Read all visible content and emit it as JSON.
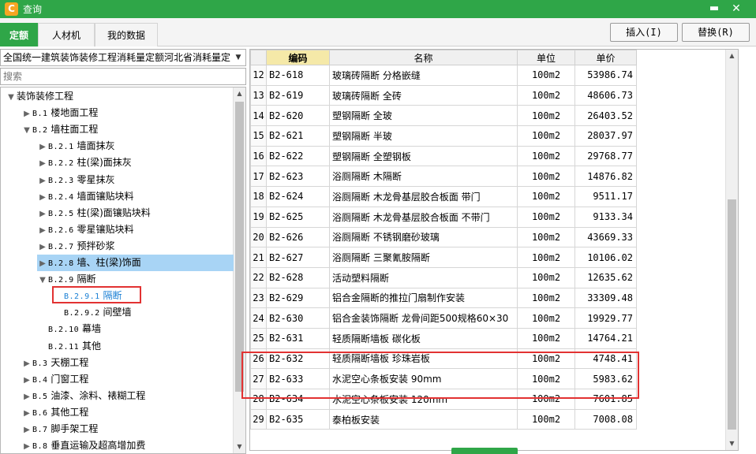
{
  "window": {
    "title": "查询",
    "app_icon": "C",
    "min_glyph": "▬",
    "close_glyph": "✕"
  },
  "tabs": [
    {
      "label": "定额",
      "active": true
    },
    {
      "label": "人材机",
      "active": false
    },
    {
      "label": "我的数据",
      "active": false
    }
  ],
  "toolbar": {
    "insert_label": "插入(I)",
    "replace_label": "替换(R)"
  },
  "library": {
    "selected": "全国统一建筑装饰装修工程消耗量定额河北省消耗量定"
  },
  "search": {
    "placeholder": "搜索"
  },
  "tree": [
    {
      "code": "",
      "label": "装饰装修工程",
      "toggle": "▼",
      "level": 0
    },
    {
      "code": "B.1",
      "label": "楼地面工程",
      "toggle": "▶",
      "level": 1
    },
    {
      "code": "B.2",
      "label": "墙柱面工程",
      "toggle": "▼",
      "level": 1
    },
    {
      "code": "B.2.1",
      "label": "墙面抹灰",
      "toggle": "▶",
      "level": 2
    },
    {
      "code": "B.2.2",
      "label": "柱(梁)面抹灰",
      "toggle": "▶",
      "level": 2
    },
    {
      "code": "B.2.3",
      "label": "零星抹灰",
      "toggle": "▶",
      "level": 2
    },
    {
      "code": "B.2.4",
      "label": "墙面镶贴块料",
      "toggle": "▶",
      "level": 2
    },
    {
      "code": "B.2.5",
      "label": "柱(梁)面镶贴块料",
      "toggle": "▶",
      "level": 2
    },
    {
      "code": "B.2.6",
      "label": "零星镶贴块料",
      "toggle": "▶",
      "level": 2
    },
    {
      "code": "B.2.7",
      "label": "预拌砂浆",
      "toggle": "▶",
      "level": 2
    },
    {
      "code": "B.2.8",
      "label": "墙、柱(梁)饰面",
      "toggle": "▶",
      "level": 2,
      "selected": true
    },
    {
      "code": "B.2.9",
      "label": "隔断",
      "toggle": "▼",
      "level": 2
    },
    {
      "code": "B.2.9.1",
      "label": "隔断",
      "toggle": "",
      "level": 3,
      "current": true
    },
    {
      "code": "B.2.9.2",
      "label": "间壁墙",
      "toggle": "",
      "level": 3
    },
    {
      "code": "B.2.10",
      "label": "幕墙",
      "toggle": "",
      "level": 2
    },
    {
      "code": "B.2.11",
      "label": "其他",
      "toggle": "",
      "level": 2
    },
    {
      "code": "B.3",
      "label": "天棚工程",
      "toggle": "▶",
      "level": 1
    },
    {
      "code": "B.4",
      "label": "门窗工程",
      "toggle": "▶",
      "level": 1
    },
    {
      "code": "B.5",
      "label": "油漆、涂料、裱糊工程",
      "toggle": "▶",
      "level": 1
    },
    {
      "code": "B.6",
      "label": "其他工程",
      "toggle": "▶",
      "level": 1
    },
    {
      "code": "B.7",
      "label": "脚手架工程",
      "toggle": "▶",
      "level": 1
    },
    {
      "code": "B.8",
      "label": "垂直运输及超高增加费",
      "toggle": "▶",
      "level": 1
    }
  ],
  "table": {
    "headers": {
      "no": "",
      "code": "编码",
      "name": "名称",
      "unit": "单位",
      "price": "单价"
    },
    "rows": [
      {
        "no": "12",
        "code": "B2-618",
        "name": "玻璃砖隔断 分格嵌缝",
        "unit": "100m2",
        "price": "53986.74"
      },
      {
        "no": "13",
        "code": "B2-619",
        "name": "玻璃砖隔断 全砖",
        "unit": "100m2",
        "price": "48606.73"
      },
      {
        "no": "14",
        "code": "B2-620",
        "name": "塑钢隔断 全玻",
        "unit": "100m2",
        "price": "26403.52"
      },
      {
        "no": "15",
        "code": "B2-621",
        "name": "塑钢隔断 半玻",
        "unit": "100m2",
        "price": "28037.97"
      },
      {
        "no": "16",
        "code": "B2-622",
        "name": "塑钢隔断 全塑钢板",
        "unit": "100m2",
        "price": "29768.77"
      },
      {
        "no": "17",
        "code": "B2-623",
        "name": "浴厕隔断 木隔断",
        "unit": "100m2",
        "price": "14876.82"
      },
      {
        "no": "18",
        "code": "B2-624",
        "name": "浴厕隔断 木龙骨基层胶合板面 带门",
        "unit": "100m2",
        "price": "9511.17"
      },
      {
        "no": "19",
        "code": "B2-625",
        "name": "浴厕隔断 木龙骨基层胶合板面 不带门",
        "unit": "100m2",
        "price": "9133.34"
      },
      {
        "no": "20",
        "code": "B2-626",
        "name": "浴厕隔断 不锈钢磨砂玻璃",
        "unit": "100m2",
        "price": "43669.33"
      },
      {
        "no": "21",
        "code": "B2-627",
        "name": "浴厕隔断 三聚氰胺隔断",
        "unit": "100m2",
        "price": "10106.02"
      },
      {
        "no": "22",
        "code": "B2-628",
        "name": "活动塑料隔断",
        "unit": "100m2",
        "price": "12635.62"
      },
      {
        "no": "23",
        "code": "B2-629",
        "name": "铝合金隔断的推拉门扇制作安装",
        "unit": "100m2",
        "price": "33309.48"
      },
      {
        "no": "24",
        "code": "B2-630",
        "name": "铝合金装饰隔断 龙骨间距500规格60×30",
        "unit": "100m2",
        "price": "19929.77"
      },
      {
        "no": "25",
        "code": "B2-631",
        "name": "轻质隔断墙板 碳化板",
        "unit": "100m2",
        "price": "14764.21"
      },
      {
        "no": "26",
        "code": "B2-632",
        "name": "轻质隔断墙板 珍珠岩板",
        "unit": "100m2",
        "price": "4748.41"
      },
      {
        "no": "27",
        "code": "B2-633",
        "name": "水泥空心条板安装 90mm",
        "unit": "100m2",
        "price": "5983.62"
      },
      {
        "no": "28",
        "code": "B2-634",
        "name": "水泥空心条板安装 120mm",
        "unit": "100m2",
        "price": "7601.85"
      },
      {
        "no": "29",
        "code": "B2-635",
        "name": "泰柏板安装",
        "unit": "100m2",
        "price": "7008.08"
      }
    ]
  },
  "icons": {
    "dropdown": "chevron-down-icon",
    "scroll_up": "arrow-up-icon",
    "scroll_down": "arrow-down-icon",
    "highlight_color": "#e23232",
    "accent": "#2fa648"
  }
}
